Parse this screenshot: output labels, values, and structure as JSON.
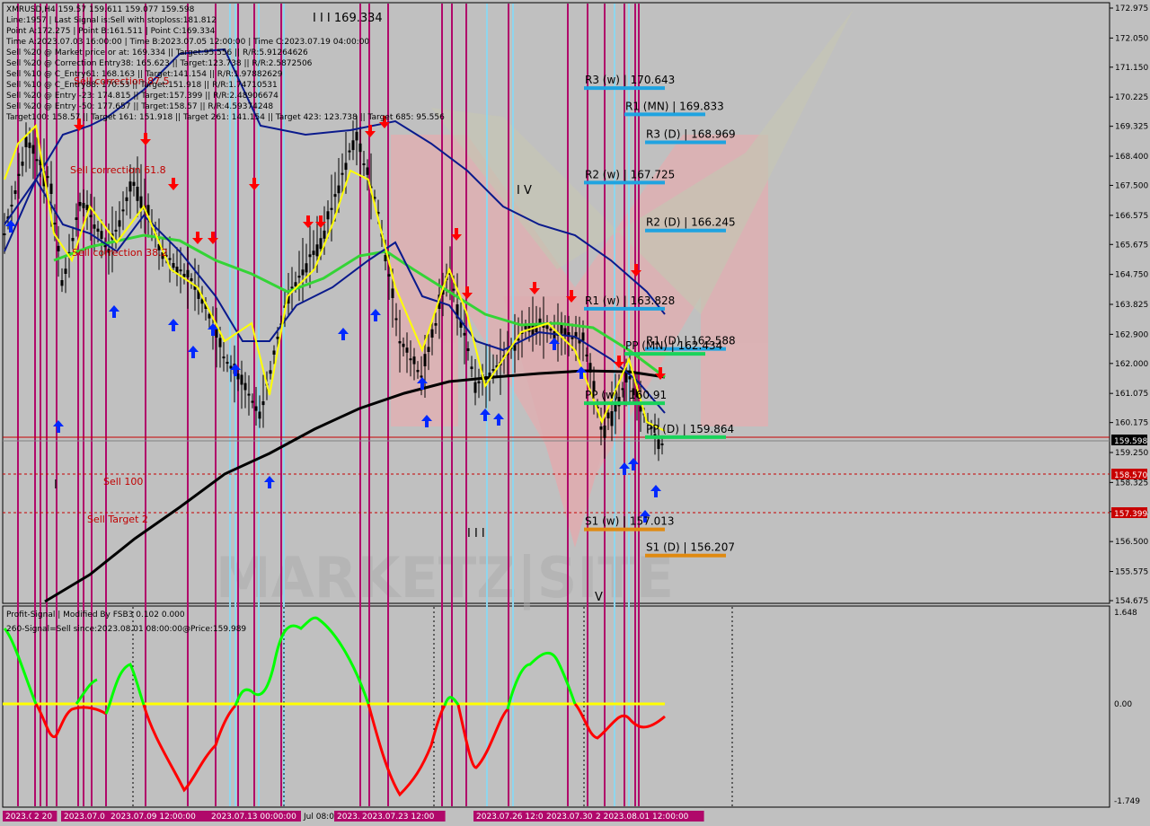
{
  "header": {
    "symbol_line": "XMRUSD,H4  159.57 159.611 159.077 159.598",
    "info_lines": [
      "Line:1957  |  Last Signal is:Sell with stoploss:181.812",
      "Point A:172.275  |  Point B:161.511  |  Point C:169.334",
      "Time A:2023.07.03 16:00:00  |  Time B:2023.07.05 12:00:00  |  Time C:2023.07.19 04:00:00",
      "Sell %20 @ Market price or at: 169.334  ||  Target:95.556  ||  R/R:5.91264626",
      "Sell %20 @ Correction Entry38: 165.623  ||  Target:123.738  ||  R/R:2.5872506",
      "Sell %10 @ C_Entry61: 168.163  ||  Target:141.154  ||  R/R:1.97882629",
      "Sell %10 @ C_Entry88: 170.53  ||  Target:151.918  ||  R/R:1.74710531",
      "Sell %20 @ Entry -23: 174.815  ||  Target:157.399  ||  R/R:2.48906674",
      "Sell %20 @ Entry -50: 177.657  ||  Target:158.57  ||  R/R:4.59374248",
      "Target100: 158.57  ||  Target 161: 151.918  ||  Target 261: 141.154  ||  Target 423: 123.738  ||  Target 685: 95.556"
    ]
  },
  "annotations": {
    "wave_labels": [
      "I I I 169.334",
      "I V",
      "I I I",
      "V",
      "I"
    ],
    "sell_correction_61": "Sell correction 61.8",
    "sell_correction_87": "Sell correction 87.5",
    "sell_correction_38": "Sell correction 38.2",
    "sell_100": "Sell 100",
    "sell_target": "Sell Target 2"
  },
  "pivot_levels": [
    {
      "label": "R3 (w) | 170.643",
      "value": 170.643,
      "color": "#1fa3e0"
    },
    {
      "label": "R1 (MN) | 169.833",
      "value": 169.833,
      "color": "#1fa3e0"
    },
    {
      "label": "R3 (D) | 168.969",
      "value": 168.969,
      "color": "#1fa3e0"
    },
    {
      "label": "R2 (w) | 167.725",
      "value": 167.725,
      "color": "#1fa3e0"
    },
    {
      "label": "R2 (D) | 166.245",
      "value": 166.245,
      "color": "#1fa3e0"
    },
    {
      "label": "R1 (w) | 163.828",
      "value": 163.828,
      "color": "#1fa3e0"
    },
    {
      "label": "R1 (D) | 162.588",
      "value": 162.588,
      "color": "#1fa3e0"
    },
    {
      "label": "PP (MN) | 162.434",
      "value": 162.434,
      "color": "#19d35a"
    },
    {
      "label": "PP (w) | 160.91",
      "value": 160.91,
      "color": "#19d35a"
    },
    {
      "label": "PP (D) | 159.864",
      "value": 159.864,
      "color": "#19d35a"
    },
    {
      "label": "S1 (w) | 157.013",
      "value": 157.013,
      "color": "#e08a10"
    },
    {
      "label": "S1 (D) | 156.207",
      "value": 156.207,
      "color": "#e08a10"
    }
  ],
  "price_tags": {
    "current": "159.598",
    "target_100": "158.570",
    "sell_target": "157.399"
  },
  "watermark": "MARKETZ|SITE",
  "indicator": {
    "title": "Profit-Signal | Modified By FSB3 0.102 0.000",
    "signal_text": "260-Signal=Sell since:2023.08.01 08:00:00@Price:159.989",
    "scale_top": "1.648",
    "scale_mid": "0.00",
    "scale_bottom": "-1.749"
  },
  "date_axis": [
    "2023.0",
    "2 20",
    "2023.07.0",
    "2023.07.09 12:00:00",
    "2023.07.13 00:00:00",
    "Jul 08:00",
    "2023.07.20 16",
    "2023.07.23 12:00",
    "2023.07.26 12:00",
    "2023.07.30 2",
    "2 2023.08.01 12:00:00"
  ],
  "chart_data": {
    "type": "line",
    "title": "XMRUSD,H4",
    "xlabel": "",
    "ylabel": "",
    "ylim": [
      154.675,
      172.975
    ],
    "y_ticks": [
      "172.975",
      "172.050",
      "171.150",
      "170.225",
      "169.325",
      "168.400",
      "167.500",
      "166.575",
      "165.675",
      "164.750",
      "163.825",
      "162.900",
      "162.000",
      "161.075",
      "160.175",
      "159.250",
      "158.325",
      "157.425",
      "156.500",
      "155.575",
      "154.675"
    ],
    "series": [],
    "points": {
      "A": {
        "time": "2023.07.03 16:00:00",
        "price": 172.275
      },
      "B": {
        "time": "2023.07.05 12:00:00",
        "price": 161.511
      },
      "C": {
        "time": "2023.07.19 04:00:00",
        "price": 169.334
      }
    },
    "last_close": 159.598,
    "grid": false
  },
  "colors": {
    "bg": "#c0c0c0",
    "candle": "#000000",
    "ma_yellow": "#ffff00",
    "ma_navy": "#0a1a8c",
    "ma_green": "#34d436",
    "ma_black": "#000000",
    "vline_magenta": "#b0086a",
    "vline_cyan": "#8ed6ee",
    "hline_red": "#c80000",
    "arrow_up": "#0028ff",
    "arrow_down": "#ff0000",
    "osc_green": "#00ff00",
    "osc_red": "#ff0000",
    "osc_zero": "#ffff00"
  }
}
